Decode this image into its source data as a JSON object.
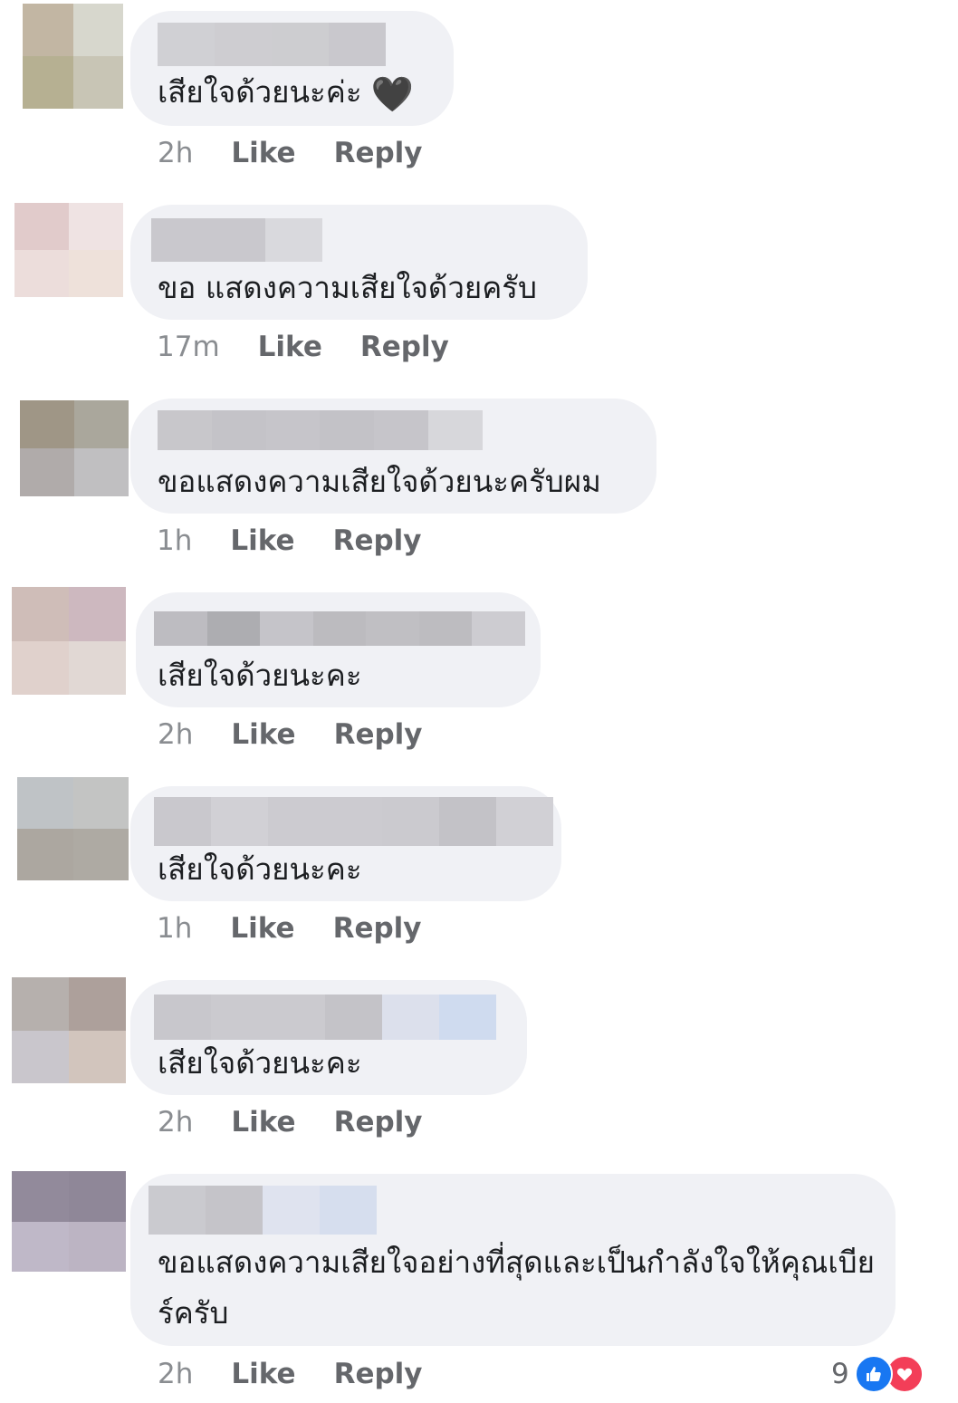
{
  "comments": [
    {
      "text": "เสียใจด้วยนะค่ะ",
      "emoji": "🖤",
      "time": "2h",
      "like": "Like",
      "reply": "Reply",
      "avatar_colors": [
        "#c2b6a3",
        "#d7d7cd",
        "#b6b092",
        "#c8c5b5"
      ],
      "name_blur_colors": [
        "#d0d0d4",
        "#cecdd1",
        "#cdcdd0",
        "#c9c8cd"
      ]
    },
    {
      "text": "ขอ แสดงความเสียใจด้วยครับ",
      "time": "17m",
      "like": "Like",
      "reply": "Reply",
      "avatar_colors": [
        "#e1cbcb",
        "#efe3e3",
        "#ecdddb",
        "#eee1da"
      ],
      "name_blur_colors": [
        "#c9c8cd",
        "#c9c8cd",
        "#d9d9dd"
      ]
    },
    {
      "text": "ขอแสดงความเสียใจด้วยนะครับผม",
      "time": "1h",
      "like": "Like",
      "reply": "Reply",
      "avatar_colors": [
        "#9f9686",
        "#aaa79c",
        "#b0abaa",
        "#c0bfc1"
      ],
      "name_blur_colors": [
        "#c8c7cb",
        "#c4c3c8",
        "#c6c5ca",
        "#c3c2c7",
        "#c6c5ca",
        "#d7d7db"
      ]
    },
    {
      "text": "เสียใจด้วยนะคะ",
      "time": "2h",
      "like": "Like",
      "reply": "Reply",
      "avatar_colors": [
        "#cfbdb8",
        "#cdb8bf",
        "#e0d1cc",
        "#e1d8d4"
      ],
      "name_blur_colors": [
        "#bdbcc1",
        "#adadb1",
        "#c5c4c9",
        "#bcbbbf",
        "#c0bfc3",
        "#bdbcc0",
        "#cdccd1"
      ]
    },
    {
      "text": "เสียใจด้วยนะคะ",
      "time": "1h",
      "like": "Like",
      "reply": "Reply",
      "avatar_colors": [
        "#bfc3c6",
        "#c3c4c3",
        "#aca7a0",
        "#aeaaa3"
      ],
      "name_blur_colors": [
        "#c9c8cd",
        "#d1d0d5",
        "#cccbd0",
        "#cccbd0",
        "#cbcacf",
        "#c3c2c7",
        "#d1d0d5"
      ]
    },
    {
      "text": "เสียใจด้วยนะคะ",
      "time": "2h",
      "like": "Like",
      "reply": "Reply",
      "avatar_colors": [
        "#b6b0ad",
        "#ada09b",
        "#c9c6cc",
        "#d2c5bd"
      ],
      "name_blur_colors": [
        "#c8c7cc",
        "#cbcacf",
        "#cbcacf",
        "#c4c3c8",
        "#dce0ec",
        "#cfdbef"
      ]
    },
    {
      "text": "ขอแสดงความเสียใจอย่างที่สุดและเป็นกำลังใจให้คุณเบียร์ครับ",
      "time": "2h",
      "like": "Like",
      "reply": "Reply",
      "reaction_count": "9",
      "avatar_colors": [
        "#928a9b",
        "#8f8798",
        "#bfb8c8",
        "#bcb4c3"
      ],
      "name_blur_colors": [
        "#cacacf",
        "#c5c4c9",
        "#dfe3ef",
        "#d6deee"
      ]
    }
  ],
  "icons": {
    "like_reaction": "thumbs-up-icon",
    "love_reaction": "heart-icon",
    "like_color": "#1877f2",
    "love_color": "#f33e58"
  }
}
